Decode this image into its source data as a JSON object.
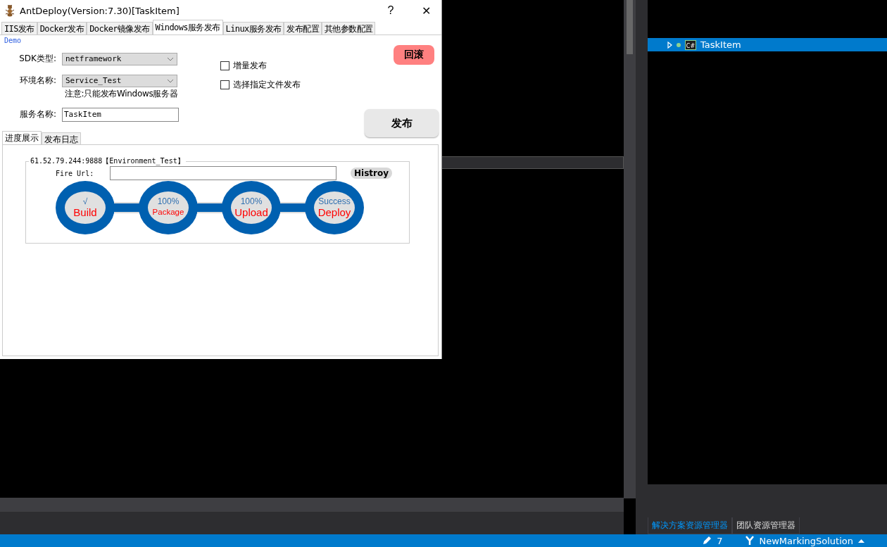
{
  "dialog": {
    "title": "AntDeploy(Version:7.30)[TaskItem]",
    "help": "?",
    "close": "✕"
  },
  "tabs": [
    {
      "label": "IIS发布",
      "selected": false
    },
    {
      "label": "Docker发布",
      "selected": false
    },
    {
      "label": "Docker镜像发布",
      "selected": false
    },
    {
      "label": "Windows服务发布",
      "selected": true
    },
    {
      "label": "Linux服务发布",
      "selected": false
    },
    {
      "label": "发布配置",
      "selected": false
    },
    {
      "label": "其他参数配置",
      "selected": false
    }
  ],
  "project": "Demo",
  "rollback_button": "回滚",
  "fields": [
    {
      "label": "SDK类型:",
      "value": "netframework",
      "kind": "dropdown"
    },
    {
      "label": "环境名称:",
      "value": "Service_Test",
      "kind": "dropdown",
      "note": "注意:只能发布Windows服务器"
    },
    {
      "label": "服务名称:",
      "value": "TaskItem",
      "kind": "text"
    }
  ],
  "options": [
    {
      "label": "增量发布",
      "checked": false
    },
    {
      "label": "选择指定文件发布",
      "checked": false
    }
  ],
  "publish_button": "发布",
  "sub_tabs": [
    {
      "label": "进度展示",
      "selected": true
    },
    {
      "label": "发布日志",
      "selected": false
    }
  ],
  "progress": {
    "group_title": "61.52.79.244:9888【Environment_Test】",
    "fire_url_label": "Fire Url:",
    "history_button": "Histroy",
    "steps": [
      {
        "status": "√",
        "name": "Build"
      },
      {
        "status": "100%",
        "name": "Package"
      },
      {
        "status": "100%",
        "name": "Upload"
      },
      {
        "status": "Success",
        "name": "Deploy"
      }
    ]
  },
  "solution_explorer": {
    "items": [
      {
        "name": "TaskItem",
        "icon": "C#",
        "selected": true
      }
    ],
    "tabs": [
      {
        "label": "解决方案资源管理器",
        "selected": true
      },
      {
        "label": "团队资源管理器",
        "selected": false
      }
    ]
  },
  "status_bar": {
    "changes": "7",
    "branch": "NewMarkingSolution"
  }
}
